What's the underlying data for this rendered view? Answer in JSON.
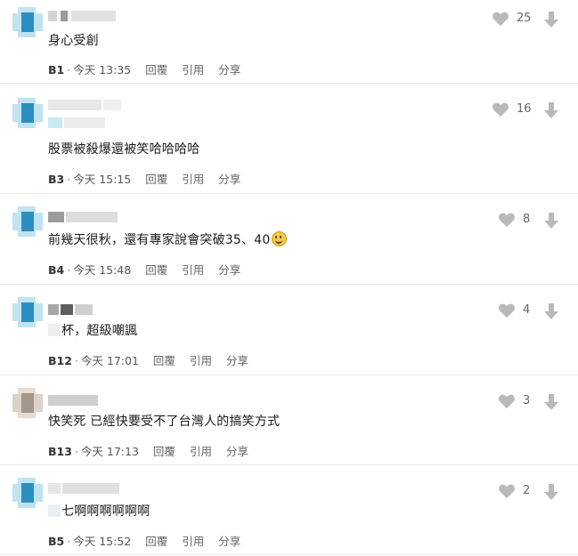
{
  "colors": {
    "icon": "#b9b9b9",
    "divider": "#e7e7e7",
    "text": "#1a1a1a",
    "meta": "#666666"
  },
  "actions": {
    "reply": "回覆",
    "quote": "引用",
    "share": "分享"
  },
  "icons": {
    "like": "heart-icon",
    "dislike": "arrow-down-icon"
  },
  "comments": [
    {
      "text": "身心受創",
      "floor": "B1",
      "time": "今天 13:35",
      "likes": "25"
    },
    {
      "text": "股票被殺爆還被笑哈哈哈哈",
      "floor": "B3",
      "time": "今天 15:15",
      "likes": "16"
    },
    {
      "text": "前幾天很秋，還有專家說會突破35、40",
      "floor": "B4",
      "time": "今天 15:48",
      "likes": "8"
    },
    {
      "text": "杯，超級嘲諷",
      "floor": "B12",
      "time": "今天 17:01",
      "likes": "4"
    },
    {
      "text": "快笑死 已經快要受不了台灣人的搞笑方式",
      "floor": "B13",
      "time": "今天 17:13",
      "likes": "3"
    },
    {
      "text": "七啊啊啊啊啊啊",
      "floor": "B5",
      "time": "今天 15:52",
      "likes": "2"
    }
  ]
}
